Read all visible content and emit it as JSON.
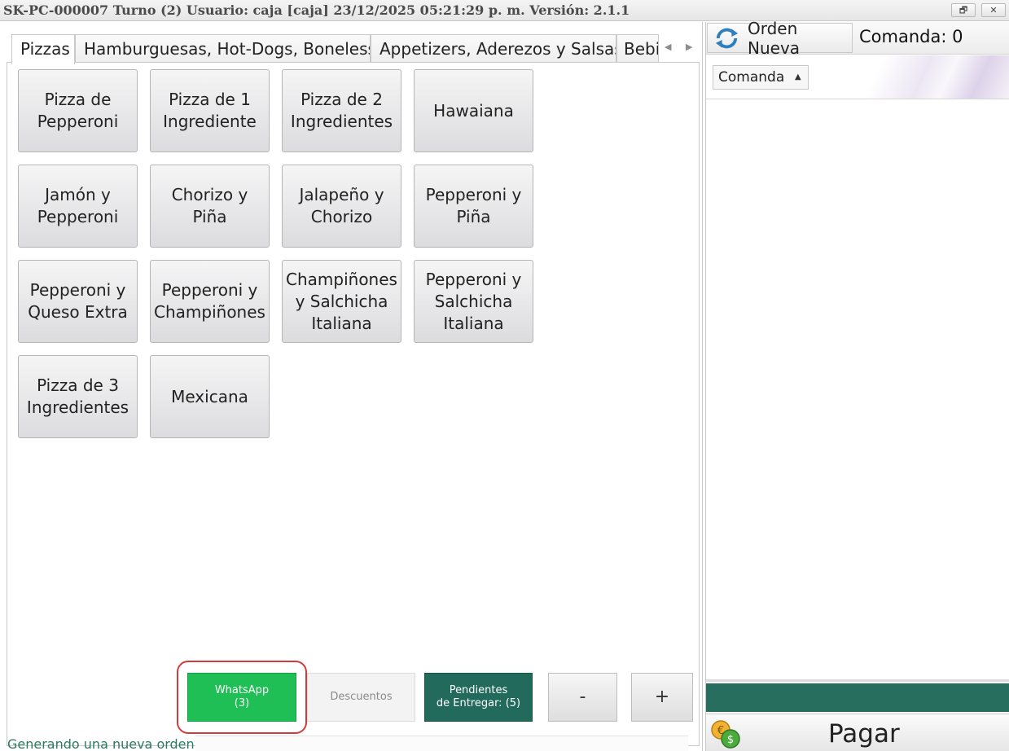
{
  "window": {
    "title": "SK-PC-000007 Turno (2) Usuario: caja [caja] 23/12/2025 05:21:29 p. m. Versión: 2.1.1",
    "restore_glyph": "🗗",
    "close_glyph": "✕"
  },
  "tabs": [
    {
      "label": "Pizzas",
      "active": true
    },
    {
      "label": "Hamburguesas, Hot-Dogs, Boneless",
      "active": false
    },
    {
      "label": "Appetizers, Aderezos y Salsas",
      "active": false
    },
    {
      "label": "Bebi",
      "active": false
    }
  ],
  "tab_scroll": {
    "left": "◀",
    "right": "▶"
  },
  "products": [
    "Pizza de Pepperoni",
    "Pizza de 1 Ingrediente",
    "Pizza de 2 Ingredientes",
    "Hawaiana",
    "Jamón y Pepperoni",
    "Chorizo y Piña",
    "Jalapeño y Chorizo",
    "Pepperoni y Piña",
    "Pepperoni y Queso Extra",
    "Pepperoni y Champiñones",
    "Champiñones y Salchicha Italiana",
    "Pepperoni y Salchicha Italiana",
    "Pizza de 3 Ingredientes",
    "Mexicana"
  ],
  "actions": {
    "whatsapp": {
      "label": "WhatsApp",
      "count": "(3)"
    },
    "descuentos": {
      "label": "Descuentos"
    },
    "pendientes": {
      "line1": "Pendientes",
      "line2": "de Entregar: (5)"
    },
    "minus": "-",
    "plus": "+"
  },
  "status": {
    "text": "Generando una nueva orden"
  },
  "order_panel": {
    "new_order_label": "Orden Nueva",
    "comanda_title": "Comanda: 0",
    "group_column": "Comanda",
    "sort_glyph": "▲",
    "pay_label": "Pagar"
  },
  "colors": {
    "whatsapp": "#1fbf55",
    "pendientes": "#216a5c",
    "total_bar": "#276e5f",
    "highlight": "#d23b3b"
  }
}
